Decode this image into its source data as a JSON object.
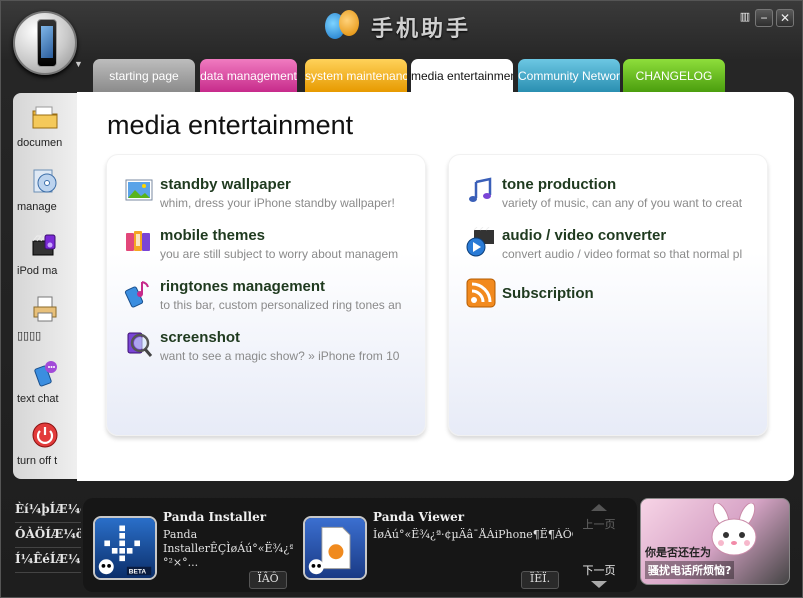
{
  "app": {
    "logo_text": "手机助手"
  },
  "window_controls": {
    "mini_glyph": "▥",
    "minimize_glyph": "−",
    "close_glyph": "✕"
  },
  "tabs": [
    {
      "label": "starting page",
      "color": "#9e9e9e"
    },
    {
      "label": "data management",
      "color": "#d9479f"
    },
    {
      "label": "system maintenance",
      "color": "#f0a800"
    },
    {
      "label": "media entertainment",
      "color": "#ffffff",
      "active": true
    },
    {
      "label": "Community Network",
      "color": "#3aa2c4"
    },
    {
      "label": "CHANGELOG",
      "color": "#5ab41a"
    }
  ],
  "sidebar": {
    "items": [
      {
        "label": "documen",
        "icon": "folder-icon"
      },
      {
        "label": "manage",
        "icon": "music-disc-icon"
      },
      {
        "label": "iPod ma",
        "icon": "ipod-media-icon"
      },
      {
        "label": "▯▯▯▯",
        "icon": "printer-icon"
      },
      {
        "label": "text chat",
        "icon": "chat-icon"
      },
      {
        "label": "turn off t",
        "icon": "power-icon"
      }
    ]
  },
  "main": {
    "title": "media entertainment",
    "left_features": [
      {
        "title": "standby wallpaper",
        "desc": "whim, dress your iPhone standby wallpaper!",
        "icon": "wallpaper-icon"
      },
      {
        "title": "mobile themes",
        "desc": "you are still subject to worry about managem",
        "icon": "themes-icon"
      },
      {
        "title": "ringtones management",
        "desc": "to this bar, custom personalized ring tones an",
        "icon": "ringtone-icon"
      },
      {
        "title": "screenshot",
        "desc": "want to see a magic show? » iPhone from 10",
        "icon": "screenshot-icon"
      }
    ],
    "right_features": [
      {
        "title": "tone production",
        "desc": "variety of music, can any of you want to creat",
        "icon": "music-note-icon"
      },
      {
        "title": "audio / video converter",
        "desc": "convert audio / video format so that normal pl",
        "icon": "converter-icon"
      },
      {
        "title": "Subscription",
        "desc": "",
        "icon": "rss-icon"
      }
    ]
  },
  "bottom_nav": [
    "Èí¼þÍÆ¼ö",
    "ÓÀÖÍÆ¼ö",
    "Í¼ÊéÍÆ¼ö"
  ],
  "promos": [
    {
      "name": "Panda Installer",
      "desc": "Panda InstallerÊÇÌøÁú°«Ë¾¿ª·¢µÄÏÂÔØ¡¢°²×°...",
      "button": "ÏÂÔ",
      "icon": "panda-installer-icon"
    },
    {
      "name": "Panda Viewer",
      "desc": "ÌøÁú°«Ë¾¿ª·¢µÄâ¯ÅÀiPhone¶Ë¶ÁÖÕÍÅ¼ä¸ñË½°é...",
      "button": "ÏÈÏ.",
      "icon": "panda-viewer-icon"
    }
  ],
  "pager": {
    "prev": "上一页",
    "next": "下一页"
  },
  "ad": {
    "line1": "你是否还在为",
    "line2": "骚扰电话所烦恼?"
  }
}
